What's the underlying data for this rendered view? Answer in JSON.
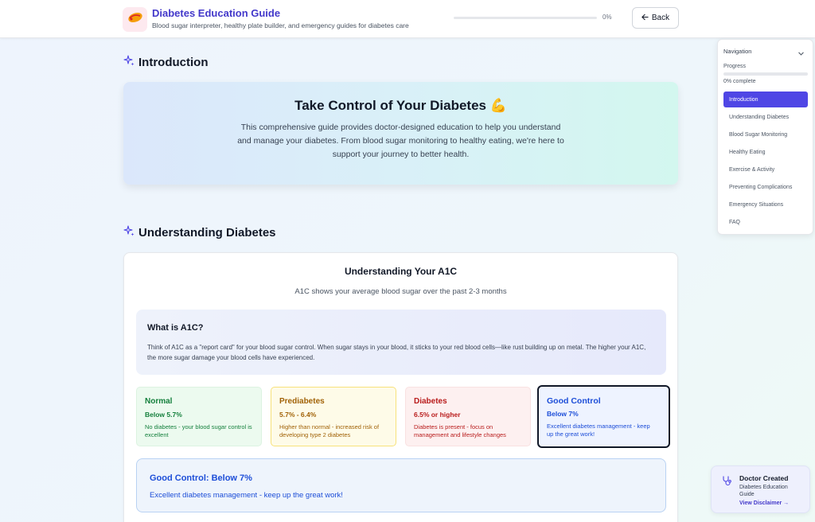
{
  "header": {
    "logo_icon": "flexed-arm-emoji-icon",
    "title": "Diabetes Education Guide",
    "subtitle": "Blood sugar interpreter, healthy plate builder, and emergency guides for diabetes care",
    "progress": 0,
    "progress_text": "0%",
    "back_label": "Back",
    "accent_color": "#4338ca"
  },
  "sections": {
    "intro": {
      "heading": "Introduction",
      "hero_title": "Take Control of Your Diabetes 💪",
      "hero_text": "This comprehensive guide provides doctor-designed education to help you understand and manage your diabetes. From blood sugar monitoring to healthy eating, we're here to support your journey to better health."
    },
    "understanding": {
      "heading": "Understanding Diabetes",
      "card_title": "Understanding Your A1C",
      "card_subtitle": "A1C shows your average blood sugar over the past 2-3 months",
      "info_title": "What is A1C?",
      "info_text": "Think of A1C as a \"report card\" for your blood sugar control. When sugar stays in your blood, it sticks to your red blood cells—like rust building up on metal. The higher your A1C, the more sugar damage your blood cells have experienced.",
      "ranges": [
        {
          "name": "Normal",
          "value": "Below 5.7%",
          "desc": "No diabetes - your blood sugar control is excellent"
        },
        {
          "name": "Prediabetes",
          "value": "5.7% - 6.4%",
          "desc": "Higher than normal - increased risk of developing type 2 diabetes"
        },
        {
          "name": "Diabetes",
          "value": "6.5% or higher",
          "desc": "Diabetes is present - focus on management and lifestyle changes"
        },
        {
          "name": "Good Control",
          "value": "Below 7%",
          "desc": "Excellent diabetes management - keep up the great work!"
        }
      ],
      "selected_title": "Good Control: Below 7%",
      "selected_text": "Excellent diabetes management - keep up the great work!"
    }
  },
  "nav": {
    "title": "Navigation",
    "progress_label": "Progress",
    "progress": 0,
    "progress_text": "0% complete",
    "items": [
      {
        "label": "Introduction",
        "active": true
      },
      {
        "label": "Understanding Diabetes"
      },
      {
        "label": "Blood Sugar Monitoring"
      },
      {
        "label": "Healthy Eating"
      },
      {
        "label": "Exercise & Activity"
      },
      {
        "label": "Preventing Complications"
      },
      {
        "label": "Emergency Situations"
      },
      {
        "label": "FAQ"
      }
    ]
  },
  "doctor_badge": {
    "title": "Doctor Created",
    "subtitle": "Diabetes Education Guide",
    "link": "View Disclaimer →"
  }
}
